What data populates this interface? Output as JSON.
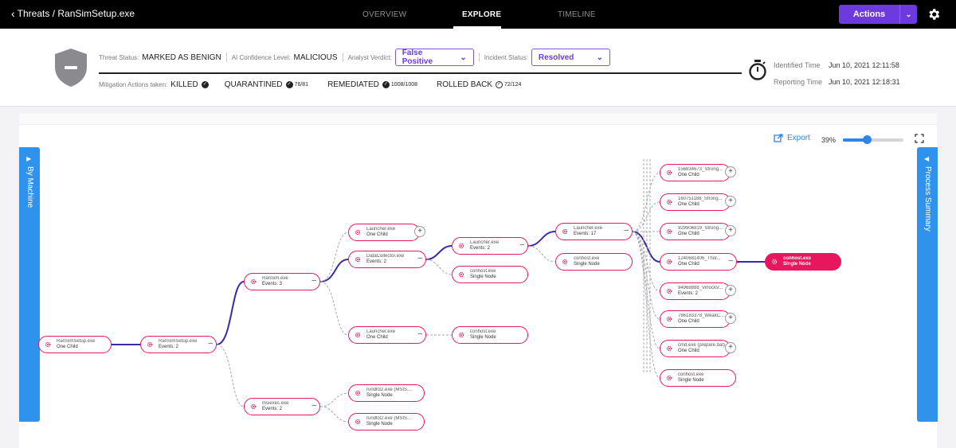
{
  "topbar": {
    "back_label": "Threats / RanSimSetup.exe",
    "tabs": [
      {
        "label": "OVERVIEW"
      },
      {
        "label": "EXPLORE"
      },
      {
        "label": "TIMELINE"
      }
    ],
    "actions_label": "Actions"
  },
  "threat": {
    "status_label": "Threat Status:",
    "status_value": "MARKED AS BENIGN",
    "ai_label": "AI Confidence Level:",
    "ai_value": "MALICIOUS",
    "verdict_label": "Analyst Verdict:",
    "verdict_value": "False Positive",
    "incident_label": "Incident Status:",
    "incident_value": "Resolved",
    "mitigation_label": "Mitigation Actions taken:",
    "killed": "KILLED",
    "quarantined": "QUARANTINED",
    "quarantined_count": "76/81",
    "remediated": "REMEDIATED",
    "remediated_count": "1008/1008",
    "rolled_back": "ROLLED BACK",
    "rolled_back_count": "72/124",
    "identified_label": "Identified Time",
    "identified_value": "Jun 10, 2021 12:11:58",
    "reporting_label": "Reporting Time",
    "reporting_value": "Jun 10, 2021 12:18:31"
  },
  "toolbar": {
    "export_label": "Export",
    "zoom": "39%",
    "zoom_fraction": 0.39
  },
  "panels": {
    "left": "By Machine",
    "right": "Process Summary"
  },
  "colors": {
    "accent": "#6d3ae0",
    "node": "#e8175d",
    "panel": "#2f93ee",
    "edge_active": "#3b2aa8"
  },
  "nodes": [
    {
      "id": "n1",
      "name": "RanSimSetup.exe",
      "sub": "One Child"
    },
    {
      "id": "n2",
      "name": "RanSimSetup.exe",
      "sub": "Events: 2"
    },
    {
      "id": "n3",
      "name": "RanSim.exe",
      "sub": "Events: 3"
    },
    {
      "id": "n4",
      "name": "msiexec.exe",
      "sub": "Events: 2"
    },
    {
      "id": "n5",
      "name": "Launcher.exe",
      "sub": "One Child"
    },
    {
      "id": "n6",
      "name": "DataCollector.exe",
      "sub": "Events: 2"
    },
    {
      "id": "n7",
      "name": "Launcher.exe",
      "sub": "One Child"
    },
    {
      "id": "n8",
      "name": "rundll32.exe (MSIS...",
      "sub": "Single Node"
    },
    {
      "id": "n9",
      "name": "rundll32.exe (MSIS...",
      "sub": "Single Node"
    },
    {
      "id": "n10",
      "name": "Launcher.exe",
      "sub": "Events: 2"
    },
    {
      "id": "n11",
      "name": "conhost.exe",
      "sub": "Single Node"
    },
    {
      "id": "n12",
      "name": "conhost.exe",
      "sub": "Single Node"
    },
    {
      "id": "n13",
      "name": "Launcher.exe",
      "sub": "Events: 17"
    },
    {
      "id": "n14",
      "name": "conhost.exe",
      "sub": "Single Node"
    },
    {
      "id": "n15",
      "name": "156834673_Strong...",
      "sub": "One Child"
    },
    {
      "id": "n16",
      "name": "160751188_Strong...",
      "sub": "One Child"
    },
    {
      "id": "n17",
      "name": "929906919_Strong...",
      "sub": "One Child"
    },
    {
      "id": "n18",
      "name": "1240681406_Thor...",
      "sub": "One Child"
    },
    {
      "id": "n19",
      "name": "94968888_VirlockV...",
      "sub": "Events: 2"
    },
    {
      "id": "n20",
      "name": "786183378_WeakC...",
      "sub": "One Child"
    },
    {
      "id": "n21",
      "name": "cmd.exe (prepare.bat)",
      "sub": "One Child"
    },
    {
      "id": "n22",
      "name": "conhost.exe",
      "sub": "Single Node"
    },
    {
      "id": "n23",
      "name": "conhost.exe",
      "sub": "Single Node"
    }
  ]
}
